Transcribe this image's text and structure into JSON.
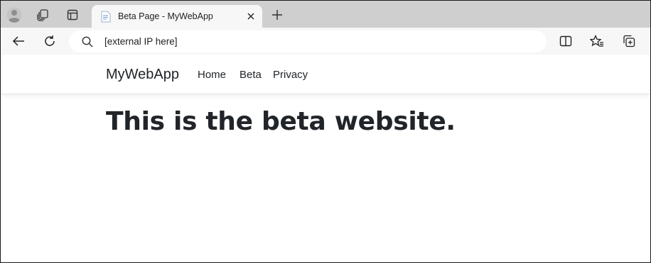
{
  "browser": {
    "tab": {
      "title": "Beta Page - MyWebApp"
    },
    "address_bar": {
      "url": "[external IP here]"
    }
  },
  "site": {
    "brand": "MyWebApp",
    "nav": [
      "Home",
      "Beta",
      "Privacy"
    ]
  },
  "content": {
    "heading": "This is the beta website."
  }
}
